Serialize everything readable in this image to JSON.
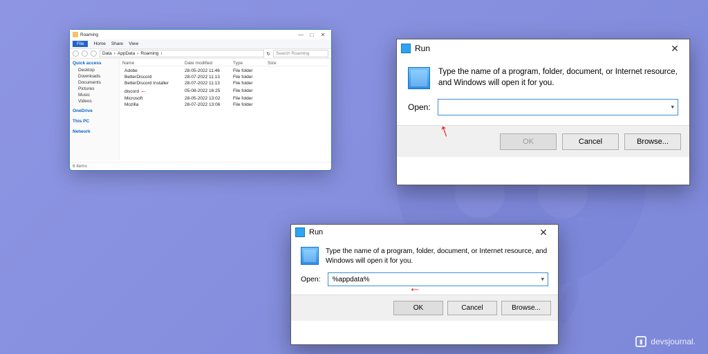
{
  "explorer": {
    "title": "Roaming",
    "tabs": {
      "file": "File",
      "home": "Home",
      "share": "Share",
      "view": "View"
    },
    "breadcrumb": [
      "Data",
      "AppData",
      "Roaming"
    ],
    "search_placeholder": "Search Roaming",
    "sidebar": {
      "quick": "Quick access",
      "items": [
        "Desktop",
        "Downloads",
        "Documents",
        "Pictures",
        "Music",
        "Videos"
      ],
      "onedrive": "OneDrive",
      "thispc": "This PC",
      "network": "Network"
    },
    "columns": {
      "name": "Name",
      "date": "Date modified",
      "type": "Type",
      "size": "Size"
    },
    "rows": [
      {
        "name": "Adobe",
        "date": "28-05-2022 11:46",
        "type": "File folder"
      },
      {
        "name": "BetterDiscord",
        "date": "28-07-2022 11:13",
        "type": "File folder"
      },
      {
        "name": "BetterDiscord Installer",
        "date": "28-07-2022 11:13",
        "type": "File folder"
      },
      {
        "name": "discord",
        "date": "05-08-2022 16:25",
        "type": "File folder",
        "arrow": true
      },
      {
        "name": "Microsoft",
        "date": "28-05-2022 13:02",
        "type": "File folder"
      },
      {
        "name": "Mozilla",
        "date": "28-07-2022 13:06",
        "type": "File folder"
      }
    ],
    "status": "6 items"
  },
  "run1": {
    "title": "Run",
    "desc": "Type the name of a program, folder, document, or Internet resource, and Windows will open it for you.",
    "open": "Open:",
    "value": "",
    "ok": "OK",
    "cancel": "Cancel",
    "browse": "Browse..."
  },
  "run2": {
    "title": "Run",
    "desc": "Type the name of a program, folder, document, or Internet resource, and Windows will open it for you.",
    "open": "Open:",
    "value": "%appdata%",
    "ok": "OK",
    "cancel": "Cancel",
    "browse": "Browse..."
  },
  "credit": "devsjournal."
}
